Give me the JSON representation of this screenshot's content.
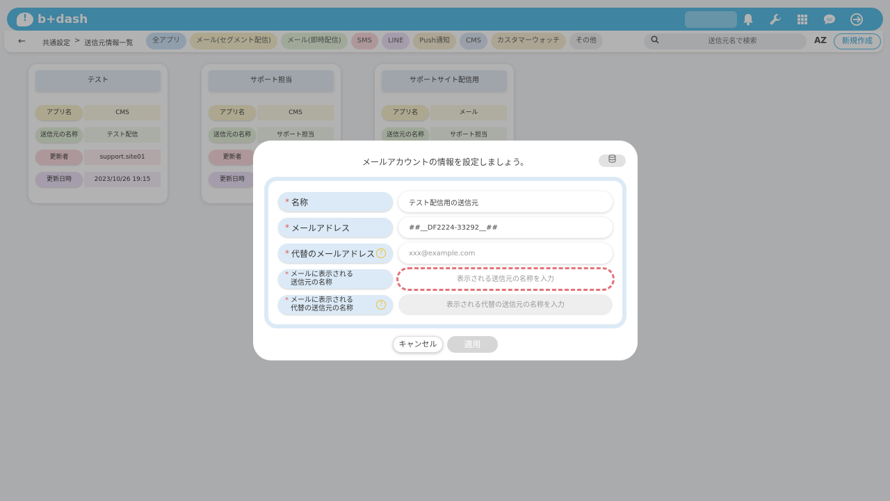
{
  "app": {
    "logo_text": "b+dash"
  },
  "subbar": {
    "back_icon": "arrow-left-icon",
    "breadcrumb": [
      "共通設定",
      ">",
      "送信元情報一覧"
    ],
    "filters": [
      {
        "label": "全アプリ",
        "color": "#cfe3f5"
      },
      {
        "label": "メール(セグメント配信)",
        "color": "#f6efcc"
      },
      {
        "label": "メール(即時配信)",
        "color": "#e6f2dc"
      },
      {
        "label": "SMS",
        "color": "#f9d9dd"
      },
      {
        "label": "LINE",
        "color": "#ece1f6"
      },
      {
        "label": "Push通知",
        "color": "#f8ecd3"
      },
      {
        "label": "CMS",
        "color": "#dbe6f3"
      },
      {
        "label": "カスタマーウォッチ",
        "color": "#f8ecd3"
      },
      {
        "label": "その他",
        "color": "#f0f0f0"
      }
    ],
    "search_placeholder": "送信元名で検索",
    "sort_label": "AZ",
    "new_button": "新規作成"
  },
  "cards": [
    {
      "title": "テスト",
      "rows": [
        {
          "label": "アプリ名",
          "value": "CMS",
          "color": "#f6efcc"
        },
        {
          "label": "送信元の名称",
          "value": "テスト配信",
          "color": "#e6f2dc"
        },
        {
          "label": "更新者",
          "value": "support.site01",
          "color": "#f9d9dd"
        },
        {
          "label": "更新日時",
          "value": "2023/10/26 19:15",
          "color": "#ece1f6"
        }
      ]
    },
    {
      "title": "サポート担当",
      "rows": [
        {
          "label": "アプリ名",
          "value": "CMS",
          "color": "#f6efcc"
        },
        {
          "label": "送信元の名称",
          "value": "サポート担当",
          "color": "#e6f2dc"
        },
        {
          "label": "更新者",
          "value": "",
          "color": "#f9d9dd"
        },
        {
          "label": "更新日時",
          "value": "",
          "color": "#ece1f6"
        }
      ]
    },
    {
      "title": "サポートサイト配信用",
      "rows": [
        {
          "label": "アプリ名",
          "value": "メール",
          "color": "#f6efcc"
        },
        {
          "label": "送信元の名称",
          "value": "サポート担当",
          "color": "#e6f2dc"
        }
      ]
    }
  ],
  "modal": {
    "title": "メールアカウントの情報を設定しましょう。",
    "db_icon": "database-icon",
    "fields": [
      {
        "label": "名称",
        "value": "テスト配信用の送信元",
        "placeholder": ""
      },
      {
        "label": "メールアドレス",
        "value": "##__DF2224-33292__##",
        "placeholder": ""
      },
      {
        "label": "代替のメールアドレス",
        "value": "",
        "placeholder": "xxx@example.com"
      },
      {
        "label_line1": "メールに表示される",
        "label_line2": "送信元の名称",
        "value": "",
        "placeholder": "表示される送信元の名称を入力"
      },
      {
        "label_line1": "メールに表示される",
        "label_line2": "代替の送信元の名称",
        "value": "",
        "placeholder": "表示される代替の送信元の名称を入力"
      }
    ],
    "cancel": "キャンセル",
    "apply": "適用"
  }
}
